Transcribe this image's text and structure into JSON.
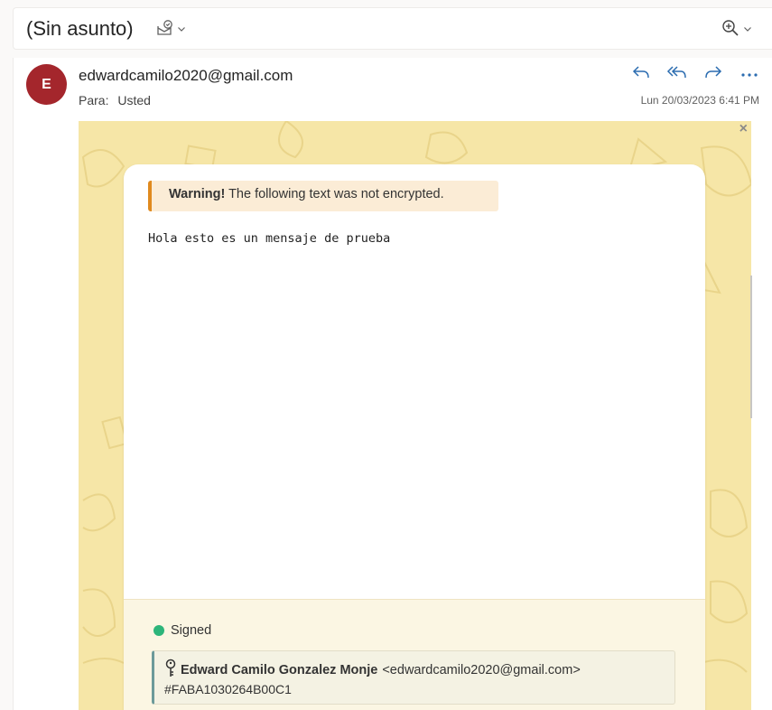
{
  "subject": {
    "title": "(Sin asunto)",
    "tag_icon": "mail-shield-icon",
    "zoom_icon": "zoom-in-icon"
  },
  "message": {
    "avatar_letter": "E",
    "avatar_color": "#a4262c",
    "sender": "edwardcamilo2020@gmail.com",
    "to_label": "Para:",
    "to_value": "Usted",
    "date": "Lun 20/03/2023 6:41 PM",
    "actions": [
      "reply-icon",
      "reply-all-icon",
      "forward-icon",
      "more-icon"
    ]
  },
  "encrypted_view": {
    "close_glyph": "×",
    "warning_bold": "Warning!",
    "warning_text": " The following text was not encrypted.",
    "body_text": "Hola esto es un mensaje de prueba",
    "signature": {
      "status": "Signed",
      "status_color": "#2db57a",
      "name": "Edward Camilo Gonzalez Monje",
      "email": "<edwardcamilo2020@gmail.com>",
      "key_id": "#FABA1030264B00C1"
    },
    "background_color": "#f6e6a7",
    "accent_color": "#e08a1e"
  }
}
